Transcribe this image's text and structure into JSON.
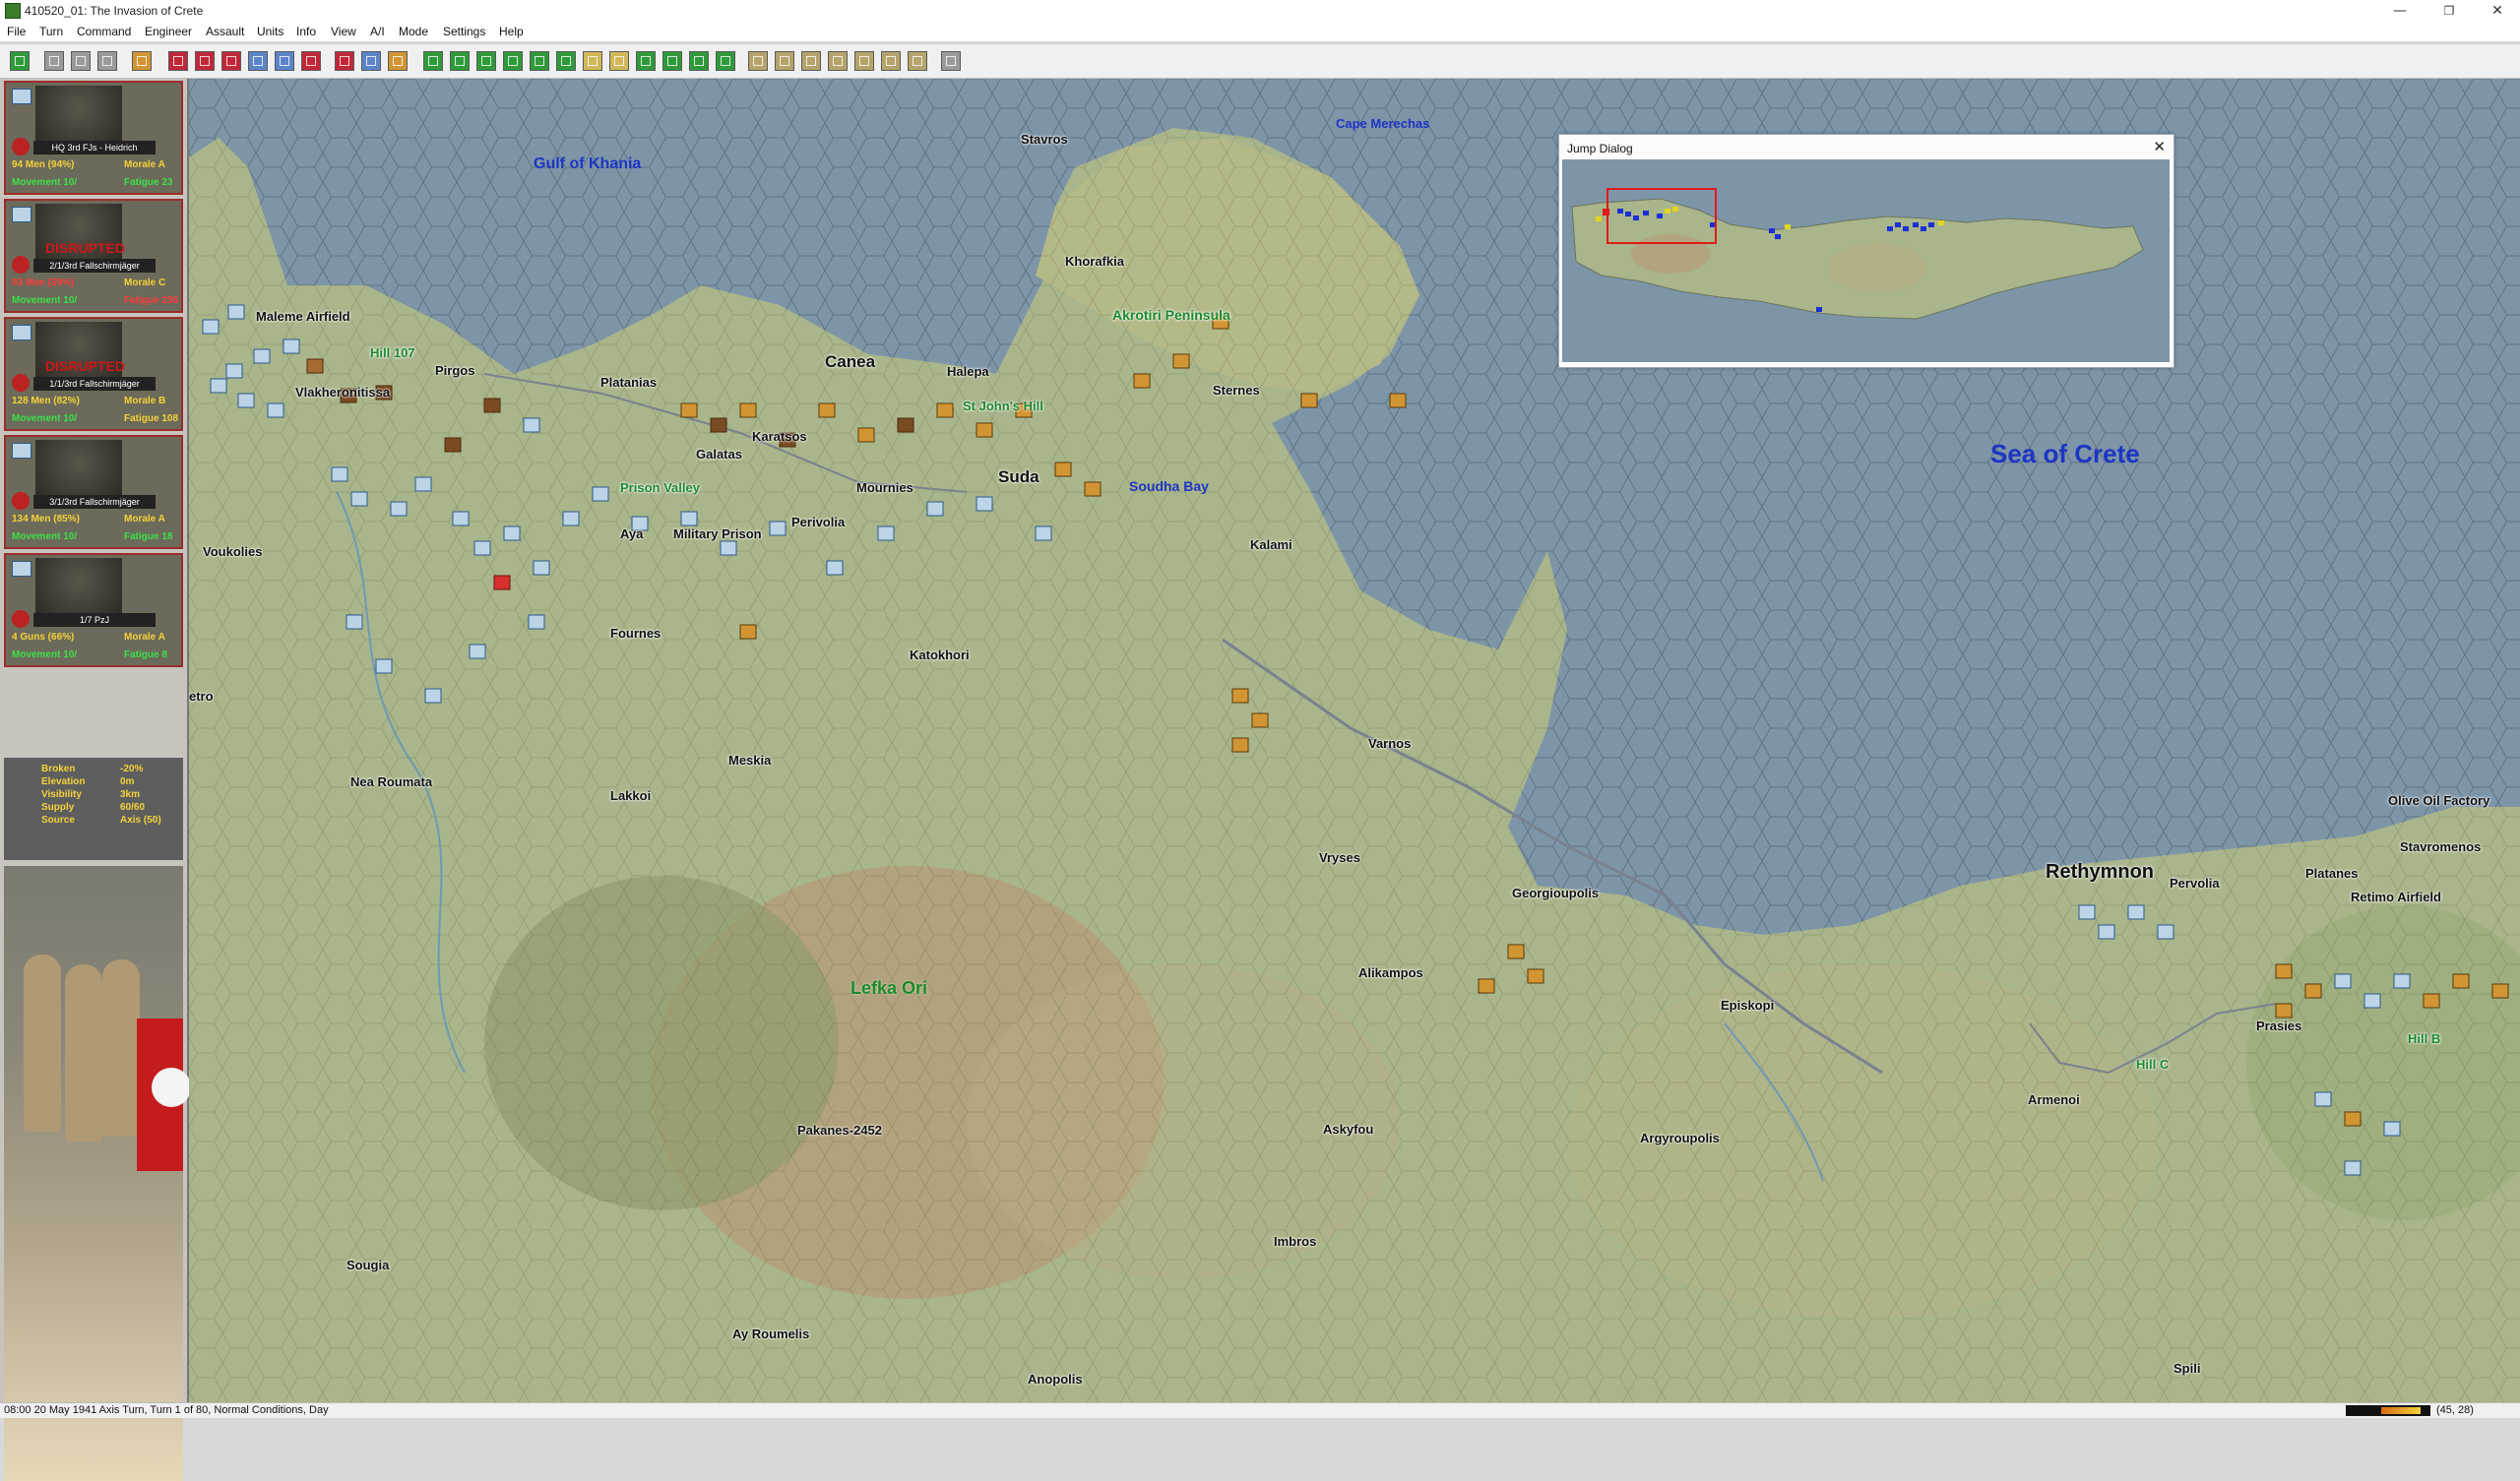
{
  "window": {
    "title": "410520_01: The Invasion of Crete",
    "minimize": "—",
    "maximize": "❐",
    "close": "✕"
  },
  "menu": [
    "File",
    "Turn",
    "Command",
    "Engineer",
    "Assault",
    "Units",
    "Info",
    "View",
    "A/I",
    "Mode",
    "Settings",
    "Help"
  ],
  "units": [
    {
      "name": "HQ 3rd FJs - Heidrich",
      "men": "94 Men (94%)",
      "morale": "Morale A",
      "movement": "Movement 10/",
      "fatigue": "Fatigue 23",
      "disrupted": ""
    },
    {
      "name": "2/1/3rd Fallschirmjäger",
      "men": "93 Men (59%)",
      "morale": "Morale C",
      "movement": "Movement 10/",
      "fatigue": "Fatigue 236",
      "disrupted": "DISRUPTED"
    },
    {
      "name": "1/1/3rd Fallschirmjäger",
      "men": "128 Men (82%)",
      "morale": "Morale B",
      "movement": "Movement 10/",
      "fatigue": "Fatigue 108",
      "disrupted": "DISRUPTED"
    },
    {
      "name": "3/1/3rd Fallschirmjäger",
      "men": "134 Men (85%)",
      "morale": "Morale A",
      "movement": "Movement 10/",
      "fatigue": "Fatigue 18",
      "disrupted": ""
    },
    {
      "name": "1/7 PzJ",
      "men": "4 Guns (66%)",
      "morale": "Morale A",
      "movement": "Movement 10/",
      "fatigue": "Fatigue 8",
      "disrupted": ""
    }
  ],
  "terrain": [
    {
      "label": "Broken",
      "value": "-20%"
    },
    {
      "label": "Elevation",
      "value": "0m"
    },
    {
      "label": "Visibility",
      "value": "3km"
    },
    {
      "label": "Supply",
      "value": "60/60"
    },
    {
      "label": "Source",
      "value": "Axis (50)"
    }
  ],
  "map_labels": {
    "gulf": "Gulf of Khania",
    "cape": "Cape Merechas",
    "sea": "Sea of Crete",
    "souda_bay": "Soudha Bay",
    "akrotiri": "Akrotiri Peninsula",
    "lefka": "Lefka Ori",
    "maleme": "Maleme Airfield",
    "hill107": "Hill 107",
    "vlakh": "Vlakheronitissa",
    "pirgos": "Pirgos",
    "platanias": "Platanias",
    "canea": "Canea",
    "halepa": "Halepa",
    "stjohns": "St John's Hill",
    "stavros": "Stavros",
    "khorafkia": "Khorafkia",
    "sternes": "Sternes",
    "karatsos": "Karatsos",
    "galatas": "Galatas",
    "prison_valley": "Prison Valley",
    "mournies": "Mournies",
    "suda": "Suda",
    "perivolia": "Perivolia",
    "military_prison": "Military Prison",
    "aya": "Aya",
    "voukolies": "Voukolies",
    "kalami": "Kalami",
    "fournes": "Fournes",
    "katokhori": "Katokhori",
    "etro": "etro",
    "varnos": "Varnos",
    "nea_roumata": "Nea Roumata",
    "lakkoi": "Lakkoi",
    "meskia": "Meskia",
    "vryses": "Vryses",
    "georgioupolis": "Georgioupolis",
    "rethymnon": "Rethymnon",
    "perivolia2": "Pervolia",
    "platanes": "Platanes",
    "olive_oil": "Olive Oil Factory",
    "stavromenos": "Stavromenos",
    "retimo": "Retimo Airfield",
    "alikampos": "Alikampos",
    "episkopi": "Episkopi",
    "prasies": "Prasies",
    "hillb": "Hill B",
    "hillc": "Hill C",
    "armenoi": "Armenoi",
    "pakanes": "Pakanes-2452",
    "askyfou": "Askyfou",
    "argyroupolis": "Argyroupolis",
    "sougia": "Sougia",
    "imbros": "Imbros",
    "ay_roumelis": "Ay Roumelis",
    "anopolis": "Anopolis",
    "spili": "Spili"
  },
  "jump_dialog": {
    "title": "Jump Dialog",
    "close": "✕"
  },
  "status": {
    "text": "08:00 20 May 1941 Axis Turn, Turn 1 of 80, Normal Conditions, Day",
    "coords": "(45, 28)"
  },
  "colors": {
    "sea": "#7e95a8",
    "land": "#a9b58a",
    "axis_unit": "#b07a2e",
    "allied_unit": "#bcd4e6"
  }
}
